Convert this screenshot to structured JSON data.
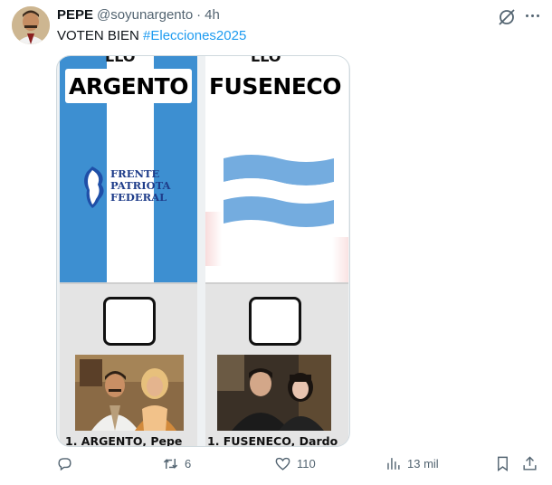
{
  "tweet": {
    "author_name": "PEPE",
    "handle": "@soyunargento",
    "separator": "·",
    "time": "4h",
    "text_plain": "VOTEN BIEN ",
    "hashtag": "#Elecciones2025"
  },
  "ballot_left": {
    "party_name": "ARGENTO",
    "cut_top_text": "LLO",
    "logo_lines": [
      "FRENTE",
      "PATRIOTA",
      "FEDERAL"
    ],
    "candidate": "1. ARGENTO, Pepe"
  },
  "ballot_right": {
    "party_name": "FUSENECO",
    "cut_top_text": "LLO",
    "candidate": "1. FUSENECO, Dardo"
  },
  "actions": {
    "replies": "",
    "retweets": "6",
    "likes": "110",
    "views": "13 mil"
  },
  "colors": {
    "link": "#1d9bf0",
    "muted": "#536471",
    "flag_blue": "#3d8fd1",
    "celeste": "#74acdf"
  },
  "icons": [
    "reply-icon",
    "retweet-icon",
    "like-icon",
    "views-icon",
    "bookmark-icon",
    "share-icon",
    "grok-icon",
    "more-icon"
  ]
}
